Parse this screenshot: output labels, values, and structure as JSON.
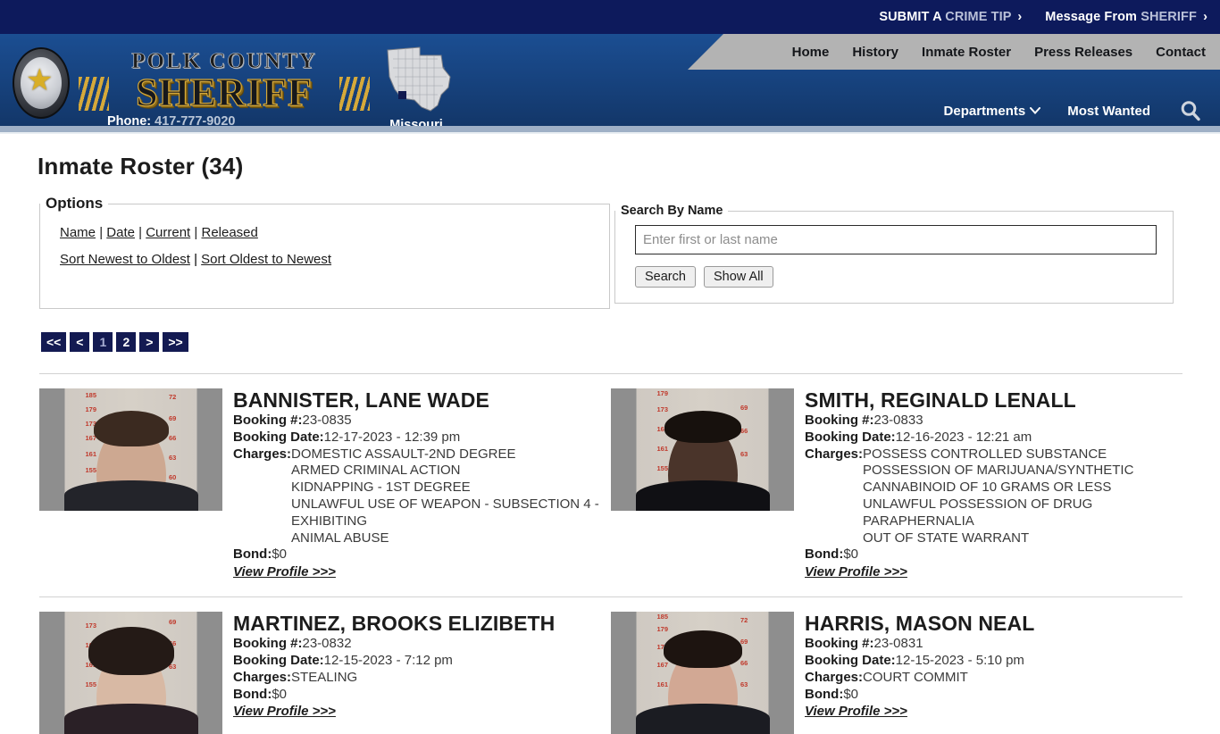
{
  "topbar": {
    "links": [
      {
        "strong": "SUBMIT A",
        "soft": "CRIME TIP",
        "chev": "›"
      },
      {
        "strong": "Message From",
        "soft": "SHERIFF",
        "chev": "›"
      }
    ]
  },
  "brand": {
    "line1": "POLK COUNTY",
    "line2": "SHERIFF",
    "phone_label": "Phone:",
    "phone_number": "417-777-9020",
    "state_label": "Missouri"
  },
  "nav": {
    "primary": [
      "Home",
      "History",
      "Inmate Roster",
      "Press Releases",
      "Contact"
    ],
    "secondary": [
      "Departments",
      "Most Wanted"
    ],
    "caret": "⌵"
  },
  "page": {
    "title": "Inmate Roster (34)"
  },
  "options": {
    "legend": "Options",
    "filters": [
      "Name",
      "Date",
      "Current",
      "Released"
    ],
    "separator": "|",
    "sorts": [
      "Sort Newest to Oldest",
      "Sort Oldest to Newest"
    ]
  },
  "search": {
    "legend": "Search By Name",
    "placeholder": "Enter first or last name",
    "value": "",
    "search_label": "Search",
    "show_all_label": "Show All"
  },
  "pagination": {
    "first": "<<",
    "prev": "<",
    "pages": [
      "1",
      "2"
    ],
    "current": "1",
    "next": ">",
    "last": ">>"
  },
  "labels": {
    "booking_no": "Booking #:",
    "booking_date": "Booking Date:",
    "charges": "Charges:",
    "bond": "Bond:",
    "view_profile": "View Profile >>>"
  },
  "inmates": [
    {
      "name": "BANNISTER, LANE WADE",
      "booking_no": "23-0835",
      "booking_date": "12-17-2023 - 12:39 pm",
      "charges": [
        "DOMESTIC ASSAULT-2ND DEGREE",
        "ARMED CRIMINAL ACTION",
        "KIDNAPPING - 1ST DEGREE",
        "UNLAWFUL USE OF WEAPON - SUBSECTION 4 - EXHIBITING",
        "ANIMAL ABUSE"
      ],
      "bond": "$0"
    },
    {
      "name": "SMITH, REGINALD LENALL",
      "booking_no": "23-0833",
      "booking_date": "12-16-2023 - 12:21 am",
      "charges": [
        "POSSESS CONTROLLED SUBSTANCE",
        "POSSESSION OF MARIJUANA/SYNTHETIC CANNABINOID OF 10 GRAMS OR LESS",
        "UNLAWFUL POSSESSION OF DRUG PARAPHERNALIA",
        "OUT OF STATE WARRANT"
      ],
      "bond": "$0"
    },
    {
      "name": "MARTINEZ, BROOKS ELIZIBETH",
      "booking_no": "23-0832",
      "booking_date": "12-15-2023 - 7:12 pm",
      "charges": [
        "STEALING"
      ],
      "bond": "$0"
    },
    {
      "name": "HARRIS, MASON NEAL",
      "booking_no": "23-0831",
      "booking_date": "12-15-2023 - 5:10 pm",
      "charges": [
        "COURT COMMIT"
      ],
      "bond": "$0"
    }
  ],
  "colors": {
    "topbar_navy": "#0d1a5c",
    "header_blue": "#17437f",
    "nav_grey": "#b3b3b3",
    "pager_navy": "#131a52",
    "link_text": "#1c1c1c"
  }
}
